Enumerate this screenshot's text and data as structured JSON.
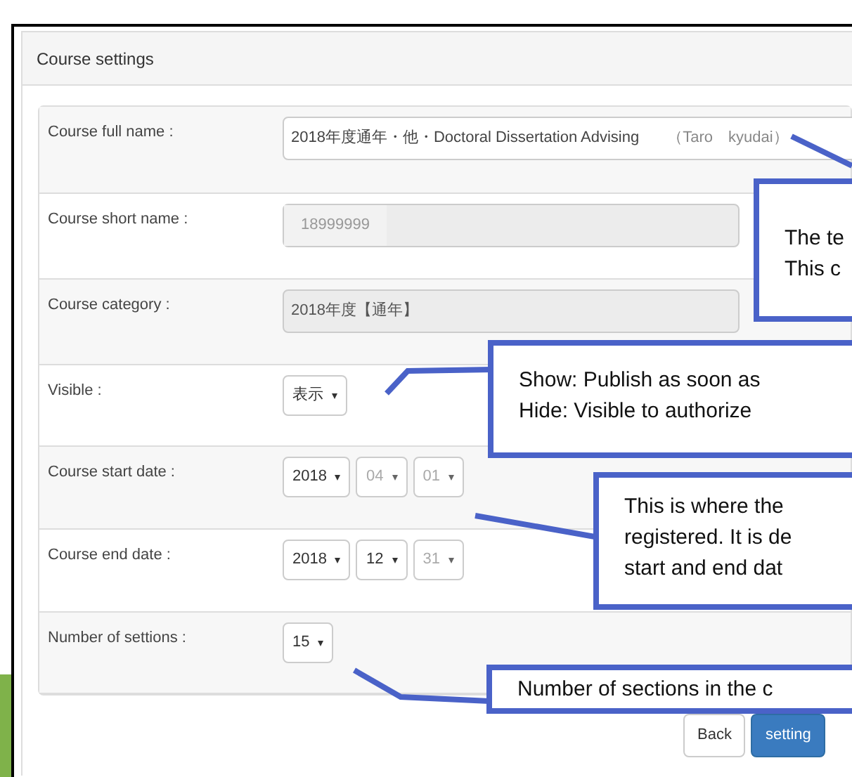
{
  "panel": {
    "title": "Course settings"
  },
  "fields": [
    {
      "label": "Course full name :",
      "kind": "text",
      "value": "2018年度通年・他・Doctoral Dissertation Advising",
      "suffix": "（Taro　kyudai）"
    },
    {
      "label": "Course short name :",
      "kind": "readonly",
      "value": "18999999"
    },
    {
      "label": "Course category :",
      "kind": "static",
      "value": "2018年度【通年】"
    },
    {
      "label": "Visible :",
      "kind": "select",
      "parts": [
        {
          "value": "表示",
          "disabled": false
        }
      ]
    },
    {
      "label": "Course start date :",
      "kind": "select",
      "parts": [
        {
          "value": "2018",
          "disabled": false
        },
        {
          "value": "04",
          "disabled": true
        },
        {
          "value": "01",
          "disabled": true
        }
      ]
    },
    {
      "label": "Course end date :",
      "kind": "select",
      "parts": [
        {
          "value": "2018",
          "disabled": false
        },
        {
          "value": "12",
          "disabled": false
        },
        {
          "value": "31",
          "disabled": true
        }
      ]
    },
    {
      "label": "Number of settions :",
      "kind": "select",
      "parts": [
        {
          "value": "15",
          "disabled": false
        }
      ]
    }
  ],
  "buttons": [
    {
      "label": "Back",
      "kind": "default"
    },
    {
      "label": "setting",
      "kind": "primary"
    }
  ],
  "callouts": [
    {
      "lines": [
        "The te",
        "This c"
      ]
    },
    {
      "lines": [
        "Show: Publish as soon as",
        "Hide: Visible to authorize"
      ]
    },
    {
      "lines": [
        "This is where the",
        "registered. It is de",
        "start and end dat"
      ]
    },
    {
      "lines": [
        "Number of sections in the c"
      ]
    }
  ]
}
